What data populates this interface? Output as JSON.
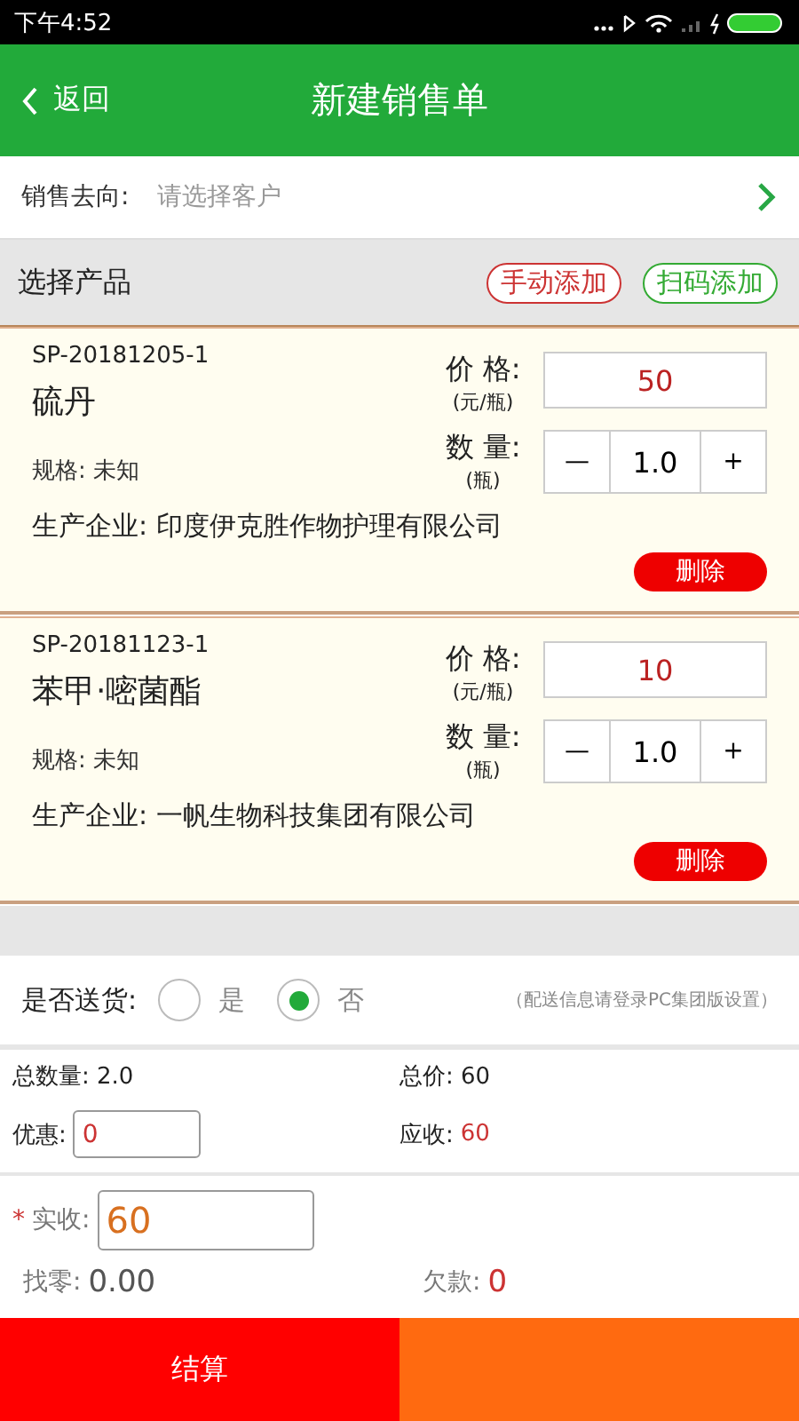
{
  "status_bar": {
    "time": "下午4:52"
  },
  "header": {
    "back": "返回",
    "title": "新建销售单"
  },
  "customer": {
    "label": "销售去向:",
    "placeholder": "请选择客户"
  },
  "products_header": {
    "title": "选择产品",
    "buttons": [
      "手动添加",
      "扫码添加"
    ]
  },
  "products": [
    {
      "code": "SP-20181205-1",
      "name": "硫丹",
      "spec": "规格: 未知",
      "price_label": "价 格:",
      "price_unit": "(元/瓶)",
      "price": "50",
      "qty_label": "数 量:",
      "qty_unit": "(瓶)",
      "minus": "—",
      "qty": "1.0",
      "plus": "+",
      "maker": "生产企业: 印度伊克胜作物护理有限公司",
      "delete": "删除"
    },
    {
      "code": "SP-20181123-1",
      "name": "苯甲·嘧菌酯",
      "spec": "规格: 未知",
      "price_label": "价 格:",
      "price_unit": "(元/瓶)",
      "price": "10",
      "qty_label": "数 量:",
      "qty_unit": "(瓶)",
      "minus": "—",
      "qty": "1.0",
      "plus": "+",
      "maker": "生产企业: 一帆生物科技集团有限公司",
      "delete": "删除"
    }
  ],
  "delivery": {
    "label": "是否送货:",
    "options": [
      {
        "label": "是",
        "selected": false
      },
      {
        "label": "否",
        "selected": true
      }
    ],
    "note": "（配送信息请登录PC集团版设置）"
  },
  "totals": {
    "total_qty": "总数量: 2.0",
    "total_price": "总价: 60",
    "discount_label": "优惠:",
    "discount": "0",
    "receivable_label": "应收:",
    "receivable": "60"
  },
  "payment": {
    "required_mark": "*",
    "paid_label": "实收:",
    "paid": "60",
    "change_label": "找零:",
    "change": "0.00",
    "debt_label": "欠款:",
    "debt": "0"
  },
  "footer": {
    "checkout": "结算"
  }
}
